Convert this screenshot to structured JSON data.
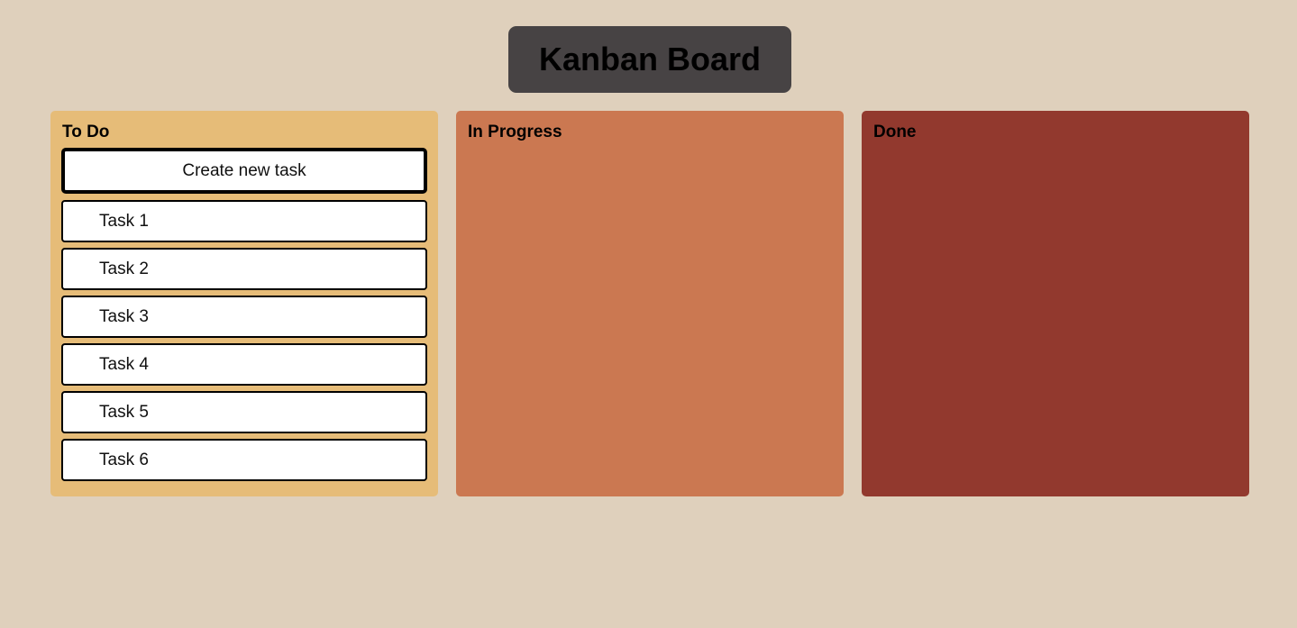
{
  "header": {
    "title": "Kanban Board"
  },
  "columns": [
    {
      "title": "To Do",
      "color": "#e6bc78",
      "create_label": "Create new task",
      "tasks": [
        "Task 1",
        "Task 2",
        "Task 3",
        "Task 4",
        "Task 5",
        "Task 6"
      ]
    },
    {
      "title": "In Progress",
      "color": "#cb7851",
      "tasks": []
    },
    {
      "title": "Done",
      "color": "#92392e",
      "tasks": []
    }
  ],
  "colors": {
    "background": "#dfd0bc",
    "header_bg": "#474344"
  }
}
